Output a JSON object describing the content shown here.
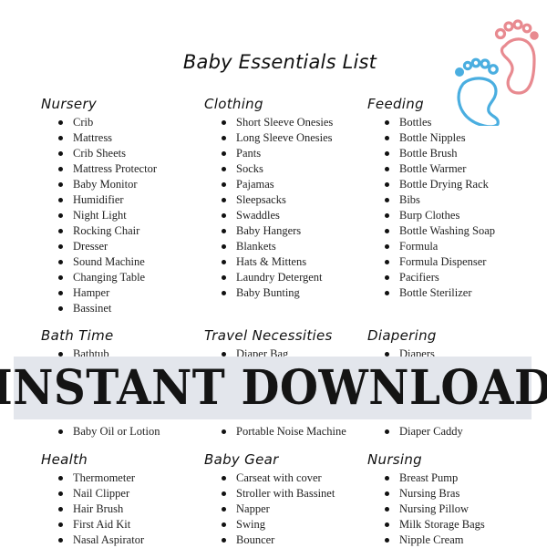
{
  "title": "Baby Essentials List",
  "banner": {
    "text": "INSTANT DOWNLOAD",
    "background": "#e3e6ec"
  },
  "decoration": {
    "icon": "baby-footprints-icon",
    "colors": {
      "left_foot": "#4aaee0",
      "right_foot": "#e88a90"
    }
  },
  "sections": [
    {
      "heading": "Nursery",
      "items": [
        "Crib",
        "Mattress",
        "Crib Sheets",
        "Mattress Protector",
        "Baby Monitor",
        "Humidifier",
        "Night Light",
        "Rocking Chair",
        "Dresser",
        "Sound Machine",
        "Changing Table",
        "Hamper",
        "Bassinet"
      ]
    },
    {
      "heading": "Clothing",
      "items": [
        "Short Sleeve Onesies",
        "Long Sleeve Onesies",
        "Pants",
        "Socks",
        "Pajamas",
        "Sleepsacks",
        "Swaddles",
        "Baby Hangers",
        "Blankets",
        "Hats & Mittens",
        "Laundry Detergent",
        "Baby Bunting"
      ]
    },
    {
      "heading": "Feeding",
      "items": [
        "Bottles",
        "Bottle Nipples",
        "Bottle Brush",
        "Bottle Warmer",
        "Bottle Drying Rack",
        "Bibs",
        "Burp Clothes",
        "Bottle Washing Soap",
        "Formula",
        "Formula Dispenser",
        "Pacifiers",
        "Bottle Sterilizer"
      ]
    },
    {
      "heading": "Bath Time",
      "items": [
        "Bathtub",
        "",
        "",
        "",
        "",
        "Baby Oil or Lotion"
      ]
    },
    {
      "heading": "Travel Necessities",
      "items": [
        "Diaper Bag",
        "",
        "",
        "",
        "",
        "Portable Noise Machine"
      ]
    },
    {
      "heading": "Diapering",
      "items": [
        "Diapers",
        "",
        "",
        "",
        "",
        "Diaper Caddy"
      ]
    },
    {
      "heading": "Health",
      "items": [
        "Thermometer",
        "Nail Clipper",
        "Hair Brush",
        "First Aid Kit",
        "Nasal Aspirator"
      ]
    },
    {
      "heading": "Baby Gear",
      "items": [
        "Carseat with cover",
        "Stroller with Bassinet",
        "Napper",
        "Swing",
        "Bouncer"
      ]
    },
    {
      "heading": "Nursing",
      "items": [
        "Breast Pump",
        "Nursing Bras",
        "Nursing Pillow",
        "Milk Storage Bags",
        "Nipple Cream"
      ]
    }
  ]
}
